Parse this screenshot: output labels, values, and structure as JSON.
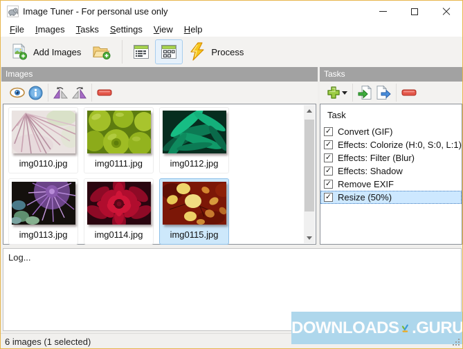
{
  "titlebar": {
    "title": "Image Tuner - For personal use only"
  },
  "menu": {
    "items": [
      "File",
      "Images",
      "Tasks",
      "Settings",
      "View",
      "Help"
    ]
  },
  "toolbar": {
    "add_images_label": "Add Images",
    "process_label": "Process"
  },
  "images_panel": {
    "title": "Images"
  },
  "tasks_panel": {
    "title": "Tasks",
    "column_header": "Task",
    "check_glyph": "✓",
    "items": [
      {
        "label": "Convert (GIF)",
        "checked": true
      },
      {
        "label": "Effects: Colorize (H:0, S:0, L:1)",
        "checked": true
      },
      {
        "label": "Effects: Filter (Blur)",
        "checked": true
      },
      {
        "label": "Effects: Shadow",
        "checked": true
      },
      {
        "label": "Remove EXIF",
        "checked": true
      },
      {
        "label": "Resize (50%)",
        "checked": true
      }
    ],
    "selected_index": 5
  },
  "thumbnails": [
    {
      "name": "img0110.jpg",
      "selected": false
    },
    {
      "name": "img0111.jpg",
      "selected": false
    },
    {
      "name": "img0112.jpg",
      "selected": false
    },
    {
      "name": "img0113.jpg",
      "selected": false
    },
    {
      "name": "img0114.jpg",
      "selected": false
    },
    {
      "name": "img0115.jpg",
      "selected": true
    }
  ],
  "log": {
    "text": "Log..."
  },
  "watermark": {
    "left": "DOWNLOADS",
    "right": ".GURU"
  },
  "statusbar": {
    "text": "6 images (1 selected)"
  },
  "colors": {
    "window_border": "#e7b64c",
    "panel_header": "#a2a2a2",
    "selection_bg": "#cde8ff",
    "selection_border": "#3a77bc",
    "toolbar_selected_bg": "#e6f1fb",
    "watermark_bg": "#aed7ec"
  }
}
